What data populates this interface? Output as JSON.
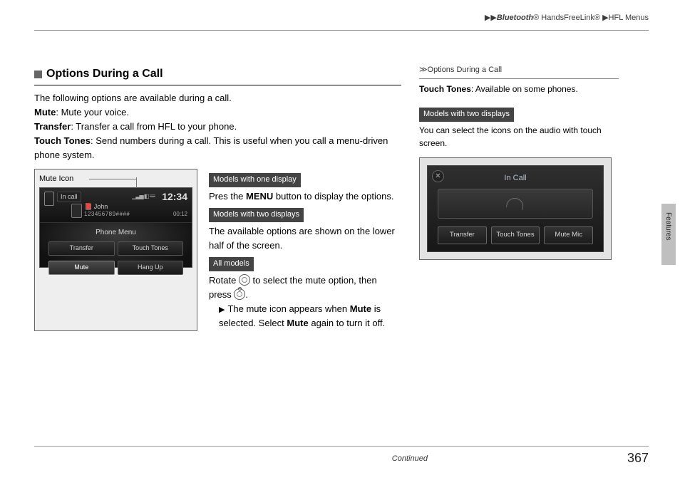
{
  "header": {
    "bt": "Bluetooth",
    "reg": "®",
    "hfl": " HandsFreeLink",
    "menus": "HFL Menus"
  },
  "section": {
    "title": "Options During a Call",
    "intro": "The following options are available during a call.",
    "mute_lbl": "Mute",
    "mute_txt": ": Mute your voice.",
    "transfer_lbl": "Transfer",
    "transfer_txt": ": Transfer a call from HFL to your phone.",
    "tt_lbl": "Touch Tones",
    "tt_txt": ": Send numbers during a call. This is useful when you call a menu-driven phone system."
  },
  "fig1": {
    "caption": "Mute Icon",
    "incall": "In call",
    "clock": "12:34",
    "signal": "▁▃▅  ◧ ≡≡",
    "name": "John",
    "number": "123456789####",
    "elapsed": "00:12",
    "pm": "Phone Menu",
    "b_transfer": "Transfer",
    "b_tt": "Touch Tones",
    "b_mute": "Mute",
    "b_hang": "Hang Up"
  },
  "tags": {
    "one": "Models with one display",
    "two": "Models with two displays",
    "all": "All models"
  },
  "rt": {
    "one_body_a": "Pres the ",
    "one_body_b": "MENU",
    "one_body_c": " button to display the options.",
    "two_body": "The available options are shown on the lower half of the screen.",
    "all_a": "Rotate ",
    "all_b": " to select the mute option, then press ",
    "all_c": ".",
    "sub_a": "The mute icon appears when ",
    "sub_b": "Mute",
    "sub_c": " is selected. Select ",
    "sub_d": "Mute",
    "sub_e": " again to turn it off."
  },
  "side": {
    "hd": "Options During a Call",
    "line1a": "Touch Tones",
    "line1b": ": Available on some phones.",
    "tag": "Models with two displays",
    "line2": "You can select the icons on the audio with touch screen."
  },
  "fig2": {
    "title": "In Call",
    "b1": "Transfer",
    "b2": "Touch Tones",
    "b3": "Mute Mic"
  },
  "sidetab": "Features",
  "footer": {
    "cont": "Continued",
    "page": "367"
  }
}
